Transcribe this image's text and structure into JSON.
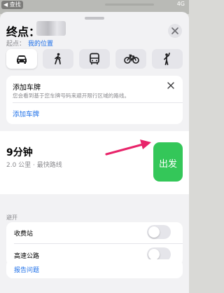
{
  "status_bar": {
    "back_label": "◀ 查找",
    "right_text": "4G"
  },
  "header": {
    "destination_label": "终点：",
    "from_label": "起点：",
    "from_value": "我的位置"
  },
  "transport_modes": [
    {
      "id": "drive",
      "icon": "car-icon",
      "active": true
    },
    {
      "id": "walk",
      "icon": "walk-icon",
      "active": false
    },
    {
      "id": "transit",
      "icon": "bus-icon",
      "active": false
    },
    {
      "id": "cycle",
      "icon": "bicycle-icon",
      "active": false
    },
    {
      "id": "rideshare",
      "icon": "person-waving-icon",
      "active": false
    }
  ],
  "plate_card": {
    "title": "添加车牌",
    "description": "您会看到基于您车牌号码来避开限行区域的路线。",
    "action": "添加车牌"
  },
  "route": {
    "time": "9分钟",
    "details": "2.0 公里 · 最快路线",
    "go_label": "出发"
  },
  "avoid": {
    "section_label": "避开",
    "options": [
      {
        "label": "收费站",
        "enabled": false
      },
      {
        "label": "高速公路",
        "enabled": false
      }
    ]
  },
  "footer": {
    "report_label": "报告问题"
  },
  "colors": {
    "accent_blue": "#1b6ee8",
    "go_green": "#34c759",
    "arrow_pink": "#e8246a"
  }
}
